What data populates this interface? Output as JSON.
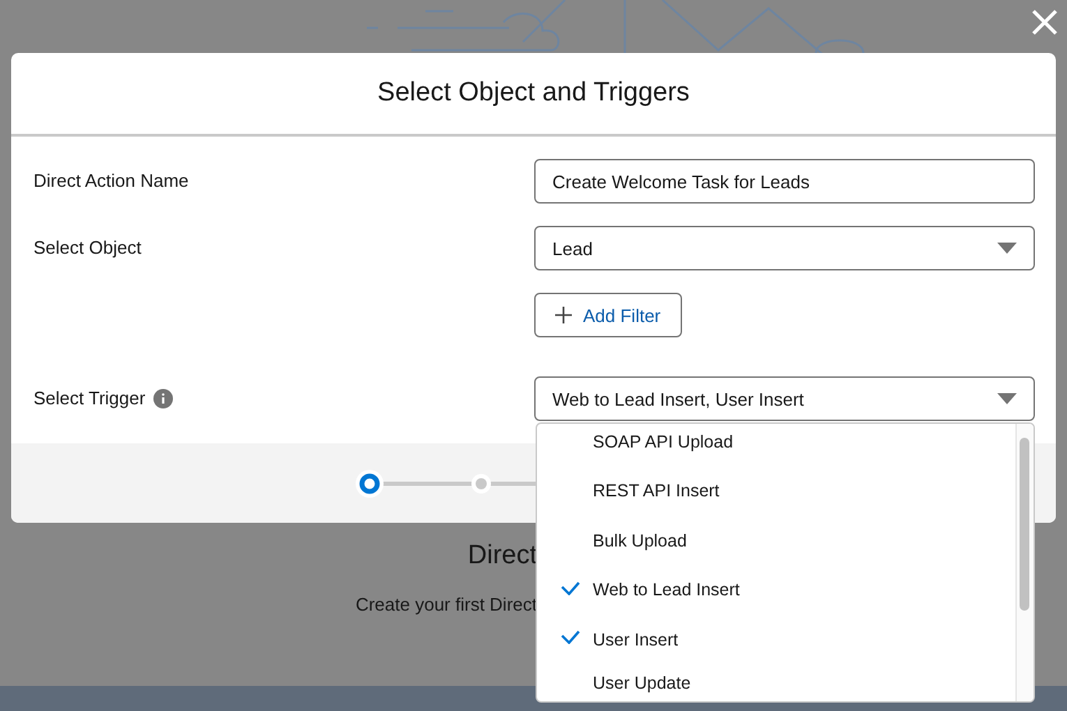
{
  "modal": {
    "title": "Select Object and Triggers",
    "fields": [
      {
        "kind": "text",
        "label": "Direct Action Name",
        "value": "Create Welcome Task for Leads"
      },
      {
        "kind": "select",
        "label": "Select Object",
        "value": "Lead"
      },
      {
        "kind": "button",
        "label": "Add Filter"
      },
      {
        "kind": "multiselect",
        "label": "Select Trigger",
        "info": true,
        "value": "Web to Lead Insert, User Insert"
      }
    ],
    "steps": [
      {
        "selected": true
      },
      {
        "selected": false
      }
    ]
  },
  "trigger_options": [
    {
      "label": "SOAP API Upload",
      "checked": false
    },
    {
      "label": "REST API Insert",
      "checked": false
    },
    {
      "label": "Bulk Upload",
      "checked": false
    },
    {
      "label": "Web to Lead Insert",
      "checked": true
    },
    {
      "label": "User Insert",
      "checked": true
    },
    {
      "label": "User Update",
      "checked": false
    }
  ],
  "background": {
    "title": "Direct",
    "subtitle": "Create your first Direct"
  }
}
